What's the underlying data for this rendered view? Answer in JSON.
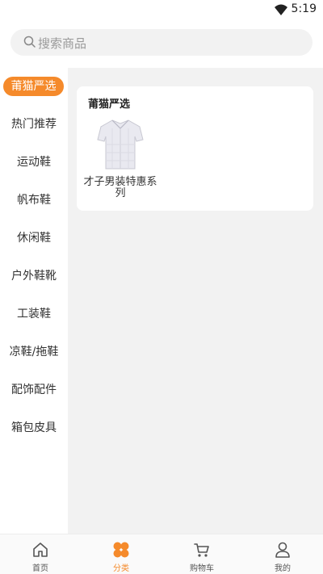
{
  "status_bar": {
    "time": "5:19"
  },
  "search": {
    "placeholder": "搜索商品"
  },
  "sidebar": {
    "items": [
      {
        "label": "莆猫严选",
        "active": true
      },
      {
        "label": "热门推荐"
      },
      {
        "label": "运动鞋"
      },
      {
        "label": "帆布鞋"
      },
      {
        "label": "休闲鞋"
      },
      {
        "label": "户外鞋靴"
      },
      {
        "label": "工装鞋"
      },
      {
        "label": "凉鞋/拖鞋"
      },
      {
        "label": "配饰配件"
      },
      {
        "label": "箱包皮具"
      }
    ]
  },
  "main": {
    "section_title": "莆猫严选",
    "products": [
      {
        "name": "才子男装特惠系列",
        "image": "shirt-image"
      }
    ]
  },
  "tabbar": {
    "items": [
      {
        "label": "首页",
        "icon": "home-icon"
      },
      {
        "label": "分类",
        "icon": "category-icon",
        "active": true
      },
      {
        "label": "购物车",
        "icon": "cart-icon"
      },
      {
        "label": "我的",
        "icon": "user-icon"
      }
    ]
  },
  "colors": {
    "accent": "#f58a2b",
    "background": "#f2f2f2"
  }
}
